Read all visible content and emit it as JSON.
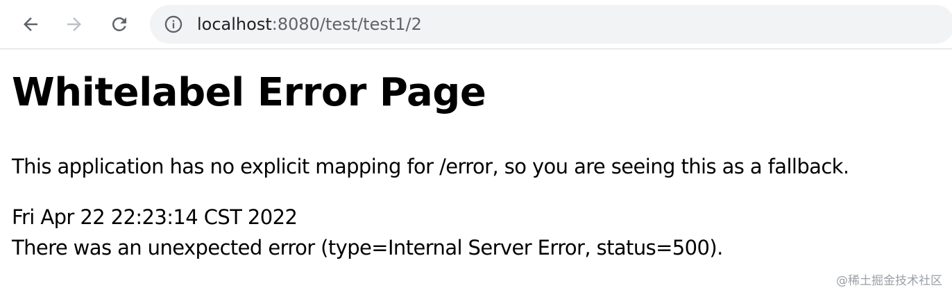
{
  "browser": {
    "url_host": "localhost",
    "url_path": ":8080/test/test1/2",
    "icons": {
      "back": "arrow-left-icon",
      "forward": "arrow-right-icon",
      "reload": "reload-icon",
      "site_info": "info-icon"
    }
  },
  "page": {
    "title": "Whitelabel Error Page",
    "message": "This application has no explicit mapping for /error, so you are seeing this as a fallback.",
    "timestamp": "Fri Apr 22 22:23:14 CST 2022",
    "error_detail": "There was an unexpected error (type=Internal Server Error, status=500)."
  },
  "watermark": "@稀土掘金技术社区",
  "colors": {
    "omnibox_bg": "#f1f3f4",
    "url_host": "#202124",
    "url_path": "#5f6368",
    "forward_disabled": "#bdc1c6"
  }
}
